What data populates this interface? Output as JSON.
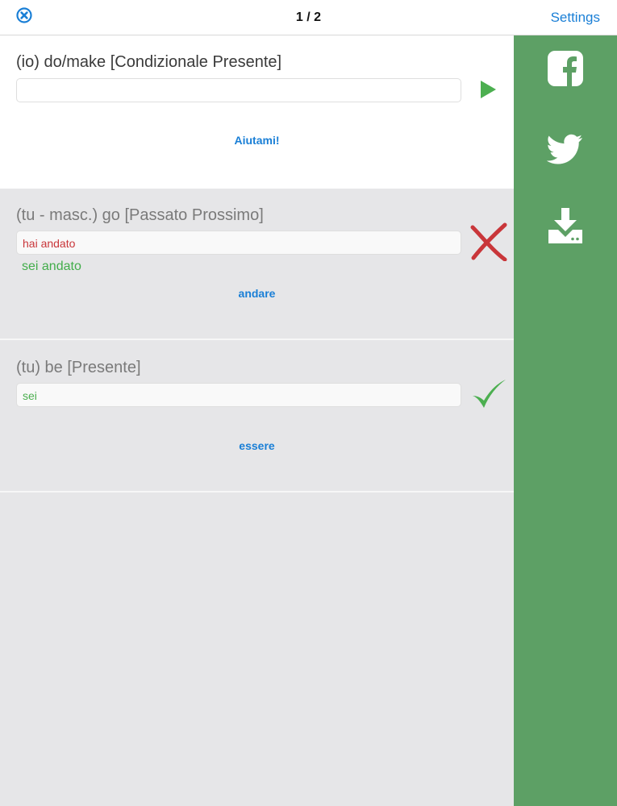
{
  "header": {
    "page_counter": "1 / 2",
    "settings_label": "Settings",
    "close_icon": "close-circle-icon"
  },
  "sidebar": {
    "color": "#5da065",
    "icons": [
      "facebook-icon",
      "twitter-icon",
      "download-icon"
    ]
  },
  "questions": [
    {
      "prompt": "(io) do/make [Condizionale Presente]",
      "answer": "",
      "hint_label": "Aiutami!",
      "state": "active",
      "action_icon": "play-icon"
    },
    {
      "prompt": "(tu - masc.) go [Passato Prossimo]",
      "answer": "hai andato",
      "correct_answer": "sei andato",
      "hint_label": "andare",
      "state": "wrong",
      "result_icon": "cross-icon"
    },
    {
      "prompt": "(tu) be [Presente]",
      "answer": "sei",
      "hint_label": "essere",
      "state": "correct",
      "result_icon": "checkmark-icon"
    }
  ],
  "colors": {
    "accent_blue": "#1a7fd6",
    "correct_green": "#4caf50",
    "wrong_red": "#c9363a"
  }
}
